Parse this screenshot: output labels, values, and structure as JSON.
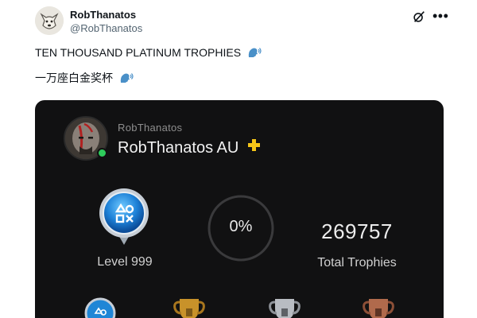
{
  "tweet": {
    "display_name": "RobThanatos",
    "handle": "@RobThanatos",
    "text_line1": "TEN THOUSAND PLATINUM TROPHIES",
    "text_line2": "一万座白金奖杯",
    "icons": [
      "avatar-dog-icon",
      "grok-icon",
      "more-icon",
      "speaking-head-emoji"
    ]
  },
  "psn_card": {
    "psn_id": "RobThanatos",
    "online_id": "RobThanatos AU",
    "level_label": "Level 999",
    "progress": "0%",
    "total_trophies": "269757",
    "total_label": "Total Trophies",
    "online": true,
    "icons": [
      "kratos-avatar",
      "ps-plus-icon",
      "level-badge-icon",
      "platinum-trophy-icon",
      "gold-trophy-icon",
      "silver-trophy-icon",
      "bronze-trophy-icon"
    ],
    "colors": {
      "card_bg": "#111112",
      "online_dot": "#2ecc5b",
      "ps_plus": "#f5c518"
    }
  }
}
